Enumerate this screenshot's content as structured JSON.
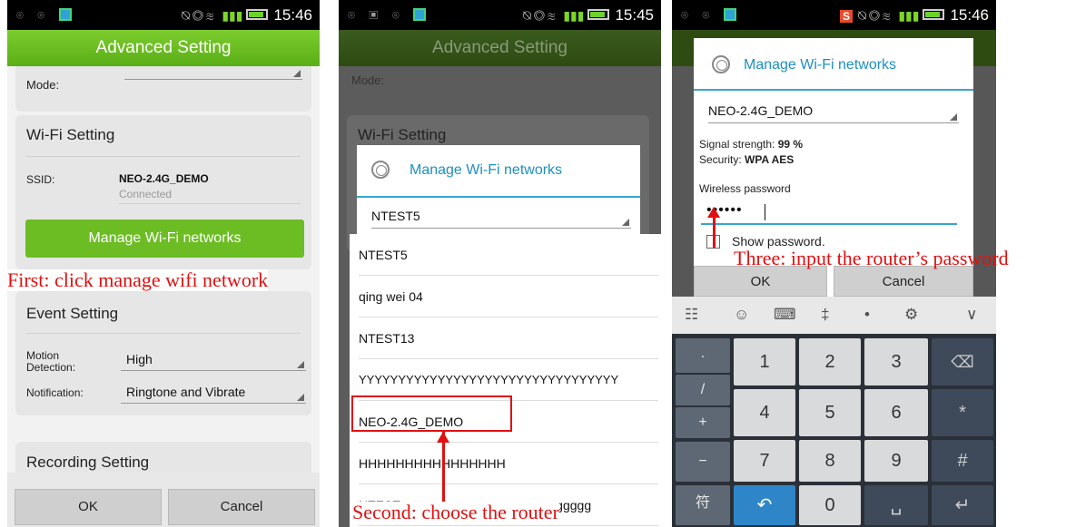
{
  "status": {
    "time1": "15:46",
    "time2": "15:45",
    "time3": "15:46",
    "s_badge": "S"
  },
  "panel1": {
    "title": "Advanced Setting",
    "mode_label": "Mode:",
    "wifi_card_title": "Wi-Fi Setting",
    "ssid_label": "SSID:",
    "ssid_value": "NEO-2.4G_DEMO",
    "ssid_status": "Connected",
    "manage_button": "Manage Wi-Fi networks",
    "event_card_title": "Event Setting",
    "motion_label": "Motion Detection:",
    "motion_value": "High",
    "notification_label": "Notification:",
    "notification_value": "Ringtone and Vibrate",
    "recording_card_title": "Recording Setting",
    "ok_button": "OK",
    "cancel_button": "Cancel",
    "annotation": "First: click manage wifi network"
  },
  "panel2": {
    "title": "Advanced Setting",
    "mode_label": "Mode:",
    "bg_card_title": "Wi-Fi Setting",
    "dialog_title": "Manage Wi-Fi networks",
    "selected_network": "NTEST5",
    "networks": [
      "NTEST5",
      "qing wei 04",
      "NTEST13",
      "YYYYYYYYYYYYYYYYYYYYYYYYYYYYYYYYY",
      "NEO-2.4G_DEMO",
      "HHHHHHHHHHHHHHHH",
      "NTESTggggggggggggggggggggggggggg"
    ],
    "annotation": "Second: choose the router"
  },
  "panel3": {
    "dialog_title": "Manage Wi-Fi networks",
    "selected_network": "NEO-2.4G_DEMO",
    "signal_label": "Signal strength:",
    "signal_value": "99 %",
    "security_label": "Security:",
    "security_value": "WPA AES",
    "password_label": "Wireless password",
    "password_value": "••••••",
    "show_password_label": "Show password.",
    "ok_button": "OK",
    "cancel_button": "Cancel",
    "annotation": "Three: input the router’s password",
    "keyboard": {
      "toolbar": [
        "☷",
        "☺",
        "⌨",
        "‡",
        "•",
        "⚙",
        "∨"
      ],
      "side_keys": [
        ".",
        "/",
        "+",
        "−"
      ],
      "rows": [
        [
          "1",
          "2",
          "3",
          "⌫"
        ],
        [
          "4",
          "5",
          "6",
          "*"
        ],
        [
          "7",
          "8",
          "9",
          "#"
        ]
      ],
      "bottom": {
        "symbol": "符",
        "back": "↶",
        "zero": "0",
        "space": "␣",
        "enter": "↵"
      }
    }
  }
}
